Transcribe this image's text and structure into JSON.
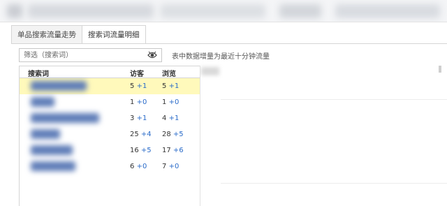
{
  "tabs": [
    {
      "label": "单品搜索流量走势"
    },
    {
      "label": "搜索词流量明细"
    }
  ],
  "filter": {
    "placeholder": "筛选（搜索词）"
  },
  "hint": "表中数据增量为最近十分钟流量",
  "table": {
    "headers": {
      "keyword": "搜索词",
      "visitors": "访客",
      "views": "浏览"
    },
    "rows": [
      {
        "visitors": "5",
        "visitors_delta": "+1",
        "views": "5",
        "views_delta": "+1"
      },
      {
        "visitors": "1",
        "visitors_delta": "+0",
        "views": "1",
        "views_delta": "+0"
      },
      {
        "visitors": "3",
        "visitors_delta": "+1",
        "views": "4",
        "views_delta": "+1"
      },
      {
        "visitors": "25",
        "visitors_delta": "+4",
        "views": "28",
        "views_delta": "+5"
      },
      {
        "visitors": "16",
        "visitors_delta": "+5",
        "views": "17",
        "views_delta": "+6"
      },
      {
        "visitors": "6",
        "visitors_delta": "+0",
        "views": "7",
        "views_delta": "+0"
      }
    ]
  },
  "colors": {
    "selected_row": "#fff9bb",
    "delta": "#2a6bc9",
    "blurred_keyword": "#5f7db8"
  },
  "icons": {
    "filter": "eye-icon"
  }
}
